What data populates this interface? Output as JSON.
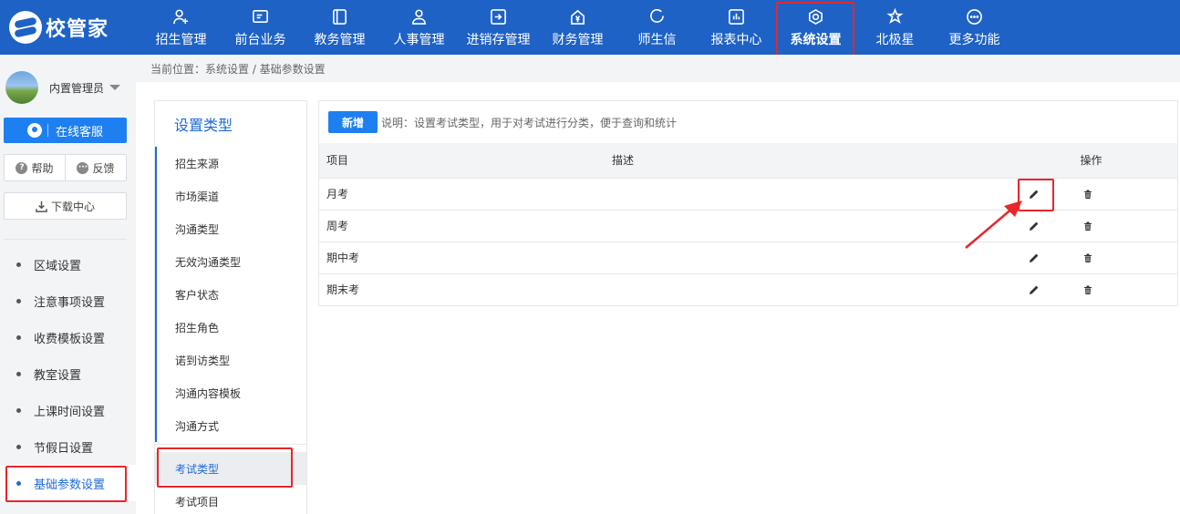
{
  "brand": {
    "name": "校管家"
  },
  "nav": [
    {
      "label": "招生管理",
      "icon": "person-plus-icon"
    },
    {
      "label": "前台业务",
      "icon": "monitor-icon"
    },
    {
      "label": "教务管理",
      "icon": "book-icon"
    },
    {
      "label": "人事管理",
      "icon": "person-icon"
    },
    {
      "label": "进销存管理",
      "icon": "box-arrow-icon"
    },
    {
      "label": "财务管理",
      "icon": "yen-house-icon"
    },
    {
      "label": "师生信",
      "icon": "chat-ring-icon"
    },
    {
      "label": "报表中心",
      "icon": "bar-chart-icon"
    },
    {
      "label": "系统设置",
      "icon": "gear-icon",
      "active": true
    },
    {
      "label": "北极星",
      "icon": "star-icon"
    },
    {
      "label": "更多功能",
      "icon": "more-icon"
    }
  ],
  "user": {
    "name": "内置管理员"
  },
  "sidebar": {
    "service_label": "在线客服",
    "help_label": "帮助",
    "feedback_label": "反馈",
    "download_label": "下载中心",
    "items": [
      {
        "label": "区域设置"
      },
      {
        "label": "注意事项设置"
      },
      {
        "label": "收费模板设置"
      },
      {
        "label": "教室设置"
      },
      {
        "label": "上课时间设置"
      },
      {
        "label": "节假日设置"
      },
      {
        "label": "基础参数设置",
        "active": true
      }
    ]
  },
  "breadcrumb": "当前位置：系统设置 / 基础参数设置",
  "settings": {
    "title": "设置类型",
    "types": [
      "招生来源",
      "市场渠道",
      "沟通类型",
      "无效沟通类型",
      "客户状态",
      "招生角色",
      "诺到访类型",
      "沟通内容模板",
      "沟通方式",
      "考试类型",
      "考试项目"
    ],
    "active_type": "考试类型"
  },
  "main": {
    "add_label": "新增",
    "note": "说明：设置考试类型，用于对考试进行分类，便于查询和统计",
    "columns": {
      "item": "项目",
      "desc": "描述",
      "ops": "操作"
    },
    "rows": [
      {
        "item": "月考",
        "desc": ""
      },
      {
        "item": "周考",
        "desc": ""
      },
      {
        "item": "期中考",
        "desc": ""
      },
      {
        "item": "期末考",
        "desc": ""
      }
    ]
  },
  "colors": {
    "nav_bg": "#1e62c6",
    "accent": "#1e80f0",
    "highlight": "#e8262b"
  }
}
